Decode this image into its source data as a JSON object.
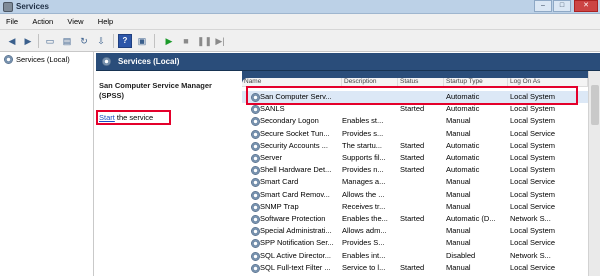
{
  "window": {
    "title": "Services",
    "minimize": "–",
    "maximize": "□",
    "close": "✕"
  },
  "menu": [
    "File",
    "Action",
    "View",
    "Help"
  ],
  "toolbar": {
    "back": "◀",
    "forward": "▶",
    "play": "▶",
    "stop": "■",
    "pause": "❚❚",
    "restart": "▶|",
    "help": "?"
  },
  "tree": {
    "root": "Services (Local)"
  },
  "header": {
    "title": "Services (Local)"
  },
  "description": {
    "service_title": "San Computer Service Manager (SPSS)",
    "start_link": "Start",
    "start_rest": " the service"
  },
  "columns": [
    "Name",
    "Description",
    "Status",
    "Startup Type",
    "Log On As"
  ],
  "rows": [
    {
      "name": "San Computer Serv...",
      "description": "",
      "status": "",
      "startup": "Automatic",
      "logon": "Local System",
      "selected": true
    },
    {
      "name": "SANLS",
      "description": "",
      "status": "Started",
      "startup": "Automatic",
      "logon": "Local System"
    },
    {
      "name": "Secondary Logon",
      "description": "Enables st...",
      "status": "",
      "startup": "Manual",
      "logon": "Local System"
    },
    {
      "name": "Secure Socket Tun...",
      "description": "Provides s...",
      "status": "",
      "startup": "Manual",
      "logon": "Local Service"
    },
    {
      "name": "Security Accounts ...",
      "description": "The startu...",
      "status": "Started",
      "startup": "Automatic",
      "logon": "Local System"
    },
    {
      "name": "Server",
      "description": "Supports fil...",
      "status": "Started",
      "startup": "Automatic",
      "logon": "Local System"
    },
    {
      "name": "Shell Hardware Det...",
      "description": "Provides n...",
      "status": "Started",
      "startup": "Automatic",
      "logon": "Local System"
    },
    {
      "name": "Smart Card",
      "description": "Manages a...",
      "status": "",
      "startup": "Manual",
      "logon": "Local Service"
    },
    {
      "name": "Smart Card Remov...",
      "description": "Allows the ...",
      "status": "",
      "startup": "Manual",
      "logon": "Local System"
    },
    {
      "name": "SNMP Trap",
      "description": "Receives tr...",
      "status": "",
      "startup": "Manual",
      "logon": "Local Service"
    },
    {
      "name": "Software Protection",
      "description": "Enables the...",
      "status": "Started",
      "startup": "Automatic (D...",
      "logon": "Network S..."
    },
    {
      "name": "Special Administrati...",
      "description": "Allows adm...",
      "status": "",
      "startup": "Manual",
      "logon": "Local System"
    },
    {
      "name": "SPP Notification Ser...",
      "description": "Provides S...",
      "status": "",
      "startup": "Manual",
      "logon": "Local Service"
    },
    {
      "name": "SQL Active Director...",
      "description": "Enables int...",
      "status": "",
      "startup": "Disabled",
      "logon": "Network S..."
    },
    {
      "name": "SQL Full-text Filter ...",
      "description": "Service to l...",
      "status": "Started",
      "startup": "Manual",
      "logon": "Local Service"
    }
  ]
}
